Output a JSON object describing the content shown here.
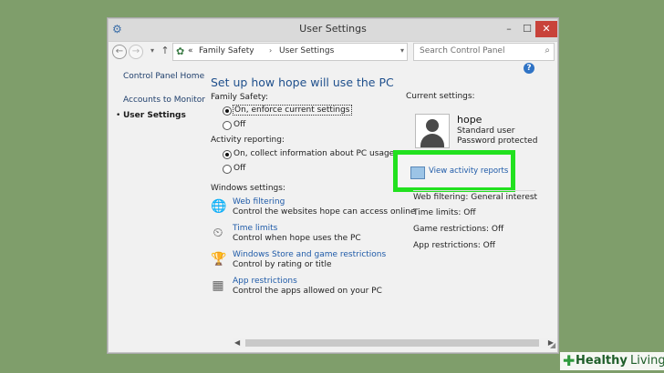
{
  "window": {
    "title": "User Settings",
    "min_glyph": "–",
    "max_glyph": "☐",
    "close_glyph": "✕"
  },
  "nav": {
    "back_glyph": "←",
    "forward_glyph": "→",
    "dropdown_glyph": "▾",
    "up_glyph": "↑",
    "breadcrumb": [
      "«",
      "Family Safety",
      "›",
      "User Settings"
    ],
    "search_placeholder": "Search Control Panel"
  },
  "sidebar": {
    "items": [
      {
        "label": "Control Panel Home"
      },
      {
        "label": "Accounts to Monitor"
      },
      {
        "label": "User Settings"
      }
    ]
  },
  "main": {
    "heading": "Set up how hope will use the PC",
    "family_safety": {
      "label": "Family Safety:",
      "options": [
        "On, enforce current settings",
        "Off"
      ],
      "selected": 0
    },
    "activity_reporting": {
      "label": "Activity reporting:",
      "options": [
        "On, collect information about PC usage",
        "Off"
      ],
      "selected": 0
    },
    "windows_settings": {
      "label": "Windows settings:",
      "items": [
        {
          "link": "Web filtering",
          "desc": "Control the websites hope can access online",
          "icon": "globe-icon"
        },
        {
          "link": "Time limits",
          "desc": "Control when hope uses the PC",
          "icon": "clock-icon"
        },
        {
          "link": "Windows Store and game restrictions",
          "desc": "Control by rating or title",
          "icon": "trophy-icon"
        },
        {
          "link": "App restrictions",
          "desc": "Control the apps allowed on your PC",
          "icon": "app-icon"
        }
      ]
    }
  },
  "current": {
    "label": "Current settings:",
    "user": {
      "name": "hope",
      "type": "Standard user",
      "password": "Password protected"
    },
    "view_reports": "View activity reports",
    "settings": [
      "Web filtering: General interest",
      "Time limits: Off",
      "Game restrictions: Off",
      "App restrictions: Off"
    ]
  },
  "colors": {
    "highlight_border": "#22e11f",
    "link": "#1e5aa8",
    "heading": "#1e4f8c",
    "background": "#7f9e6b"
  },
  "watermark": {
    "part1": "Healthy",
    "part2": "Living"
  }
}
